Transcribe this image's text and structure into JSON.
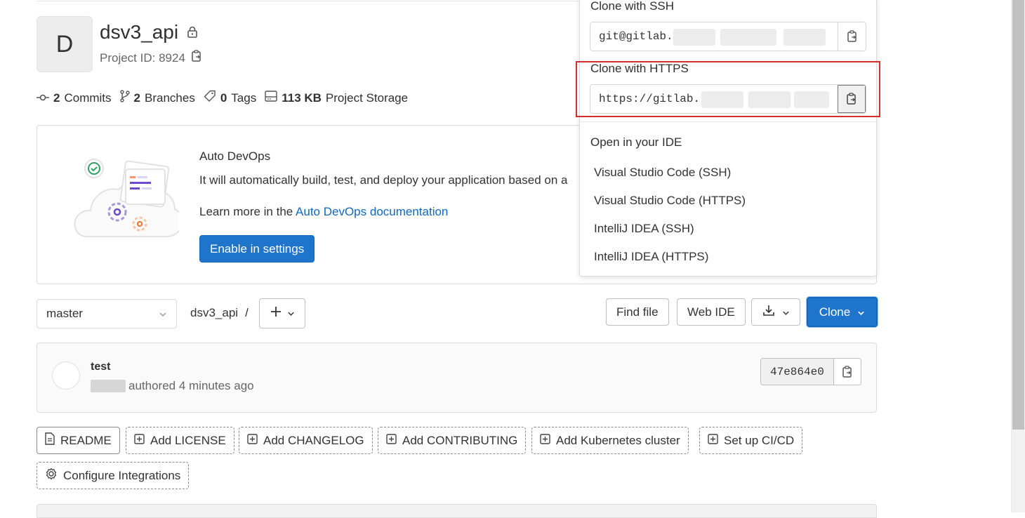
{
  "project": {
    "avatar_letter": "D",
    "name": "dsv3_api",
    "id_label": "Project ID: 8924"
  },
  "stats": {
    "commits_count": "2",
    "commits_label": "Commits",
    "branches_count": "2",
    "branches_label": "Branches",
    "tags_count": "0",
    "tags_label": "Tags",
    "storage_size": "113 KB",
    "storage_label": "Project Storage"
  },
  "devops": {
    "title": "Auto DevOps",
    "description": "It will automatically build, test, and deploy your application based on a",
    "learn_prefix": "Learn more in the ",
    "learn_link": "Auto DevOps documentation",
    "enable_button": "Enable in settings"
  },
  "repo_bar": {
    "branch": "master",
    "path": "dsv3_api",
    "path_separator": "/",
    "find_file": "Find file",
    "web_ide": "Web IDE",
    "clone": "Clone"
  },
  "commit": {
    "title": "test",
    "meta": "authored 4 minutes ago",
    "sha": "47e864e0"
  },
  "shortcuts": {
    "readme": "README",
    "add_license": "Add LICENSE",
    "add_changelog": "Add CHANGELOG",
    "add_contributing": "Add CONTRIBUTING",
    "add_kubernetes": "Add Kubernetes cluster",
    "setup_cicd": "Set up CI/CD",
    "configure_integrations": "Configure Integrations"
  },
  "clone_dropdown": {
    "ssh_label": "Clone with SSH",
    "ssh_url": "git@gitlab.",
    "https_label": "Clone with HTTPS",
    "https_url": "https://gitlab.",
    "ide_label": "Open in your IDE",
    "ide_items": [
      "Visual Studio Code (SSH)",
      "Visual Studio Code (HTTPS)",
      "IntelliJ IDEA (SSH)",
      "IntelliJ IDEA (HTTPS)"
    ]
  }
}
